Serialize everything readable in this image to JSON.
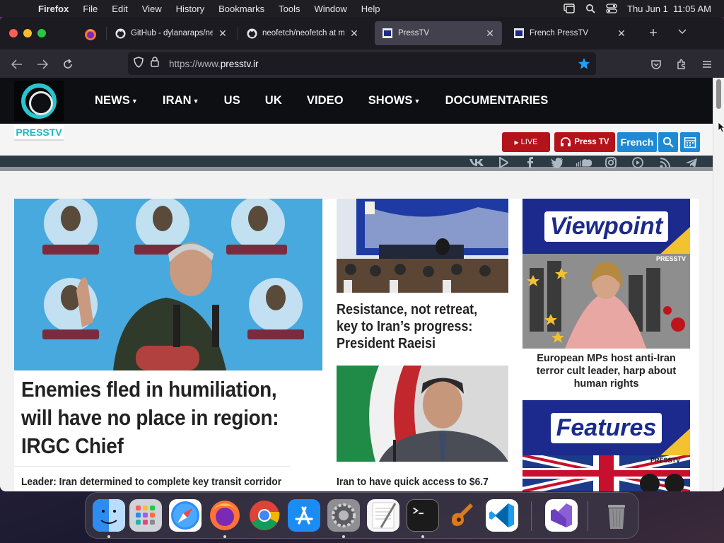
{
  "menubar": {
    "app": "Firefox",
    "items": [
      "File",
      "Edit",
      "View",
      "History",
      "Bookmarks",
      "Tools",
      "Window",
      "Help"
    ],
    "datetime": "Thu Jun 1  11:05 AM"
  },
  "tabs": [
    {
      "title": "GitHub - dylanaraps/neofetch",
      "favicon": "github-icon"
    },
    {
      "title": "neofetch/neofetch at master",
      "favicon": "github-icon"
    },
    {
      "title": "PressTV",
      "favicon": "presstv-favicon",
      "active": true
    },
    {
      "title": "French PressTV",
      "favicon": "presstv-favicon"
    }
  ],
  "urlbar": {
    "prefix": "https://www.",
    "domain": "presstv.ir"
  },
  "site": {
    "logo_label": "PRESSTV",
    "nav": [
      "NEWS",
      "IRAN",
      "US",
      "UK",
      "VIDEO",
      "SHOWS",
      "DOCUMENTARIES"
    ],
    "live_label": "LIVE",
    "presstv_button": "Press TV",
    "french_button": "French"
  },
  "articles": {
    "lead_title": "Enemies fled in humiliation, will have no place in region: IRGC Chief",
    "lead_sub": "Leader: Iran determined to complete key transit corridor",
    "mid1_title": "Resistance, not retreat, key to Iran’s progress: President Raeisi",
    "mid2_title": "Iran to have quick access to $6.7",
    "viewpoint_label": "Viewpoint",
    "viewpoint_title": "European MPs host anti-Iran terror cult leader, harp about human rights",
    "features_label": "Features",
    "banner_watermark": "PRESSTV"
  },
  "colors": {
    "live_red": "#b3131b",
    "accent_blue": "#1e8ad6",
    "brand_teal": "#27c6cf",
    "banner_blue": "#1b2a8c"
  }
}
